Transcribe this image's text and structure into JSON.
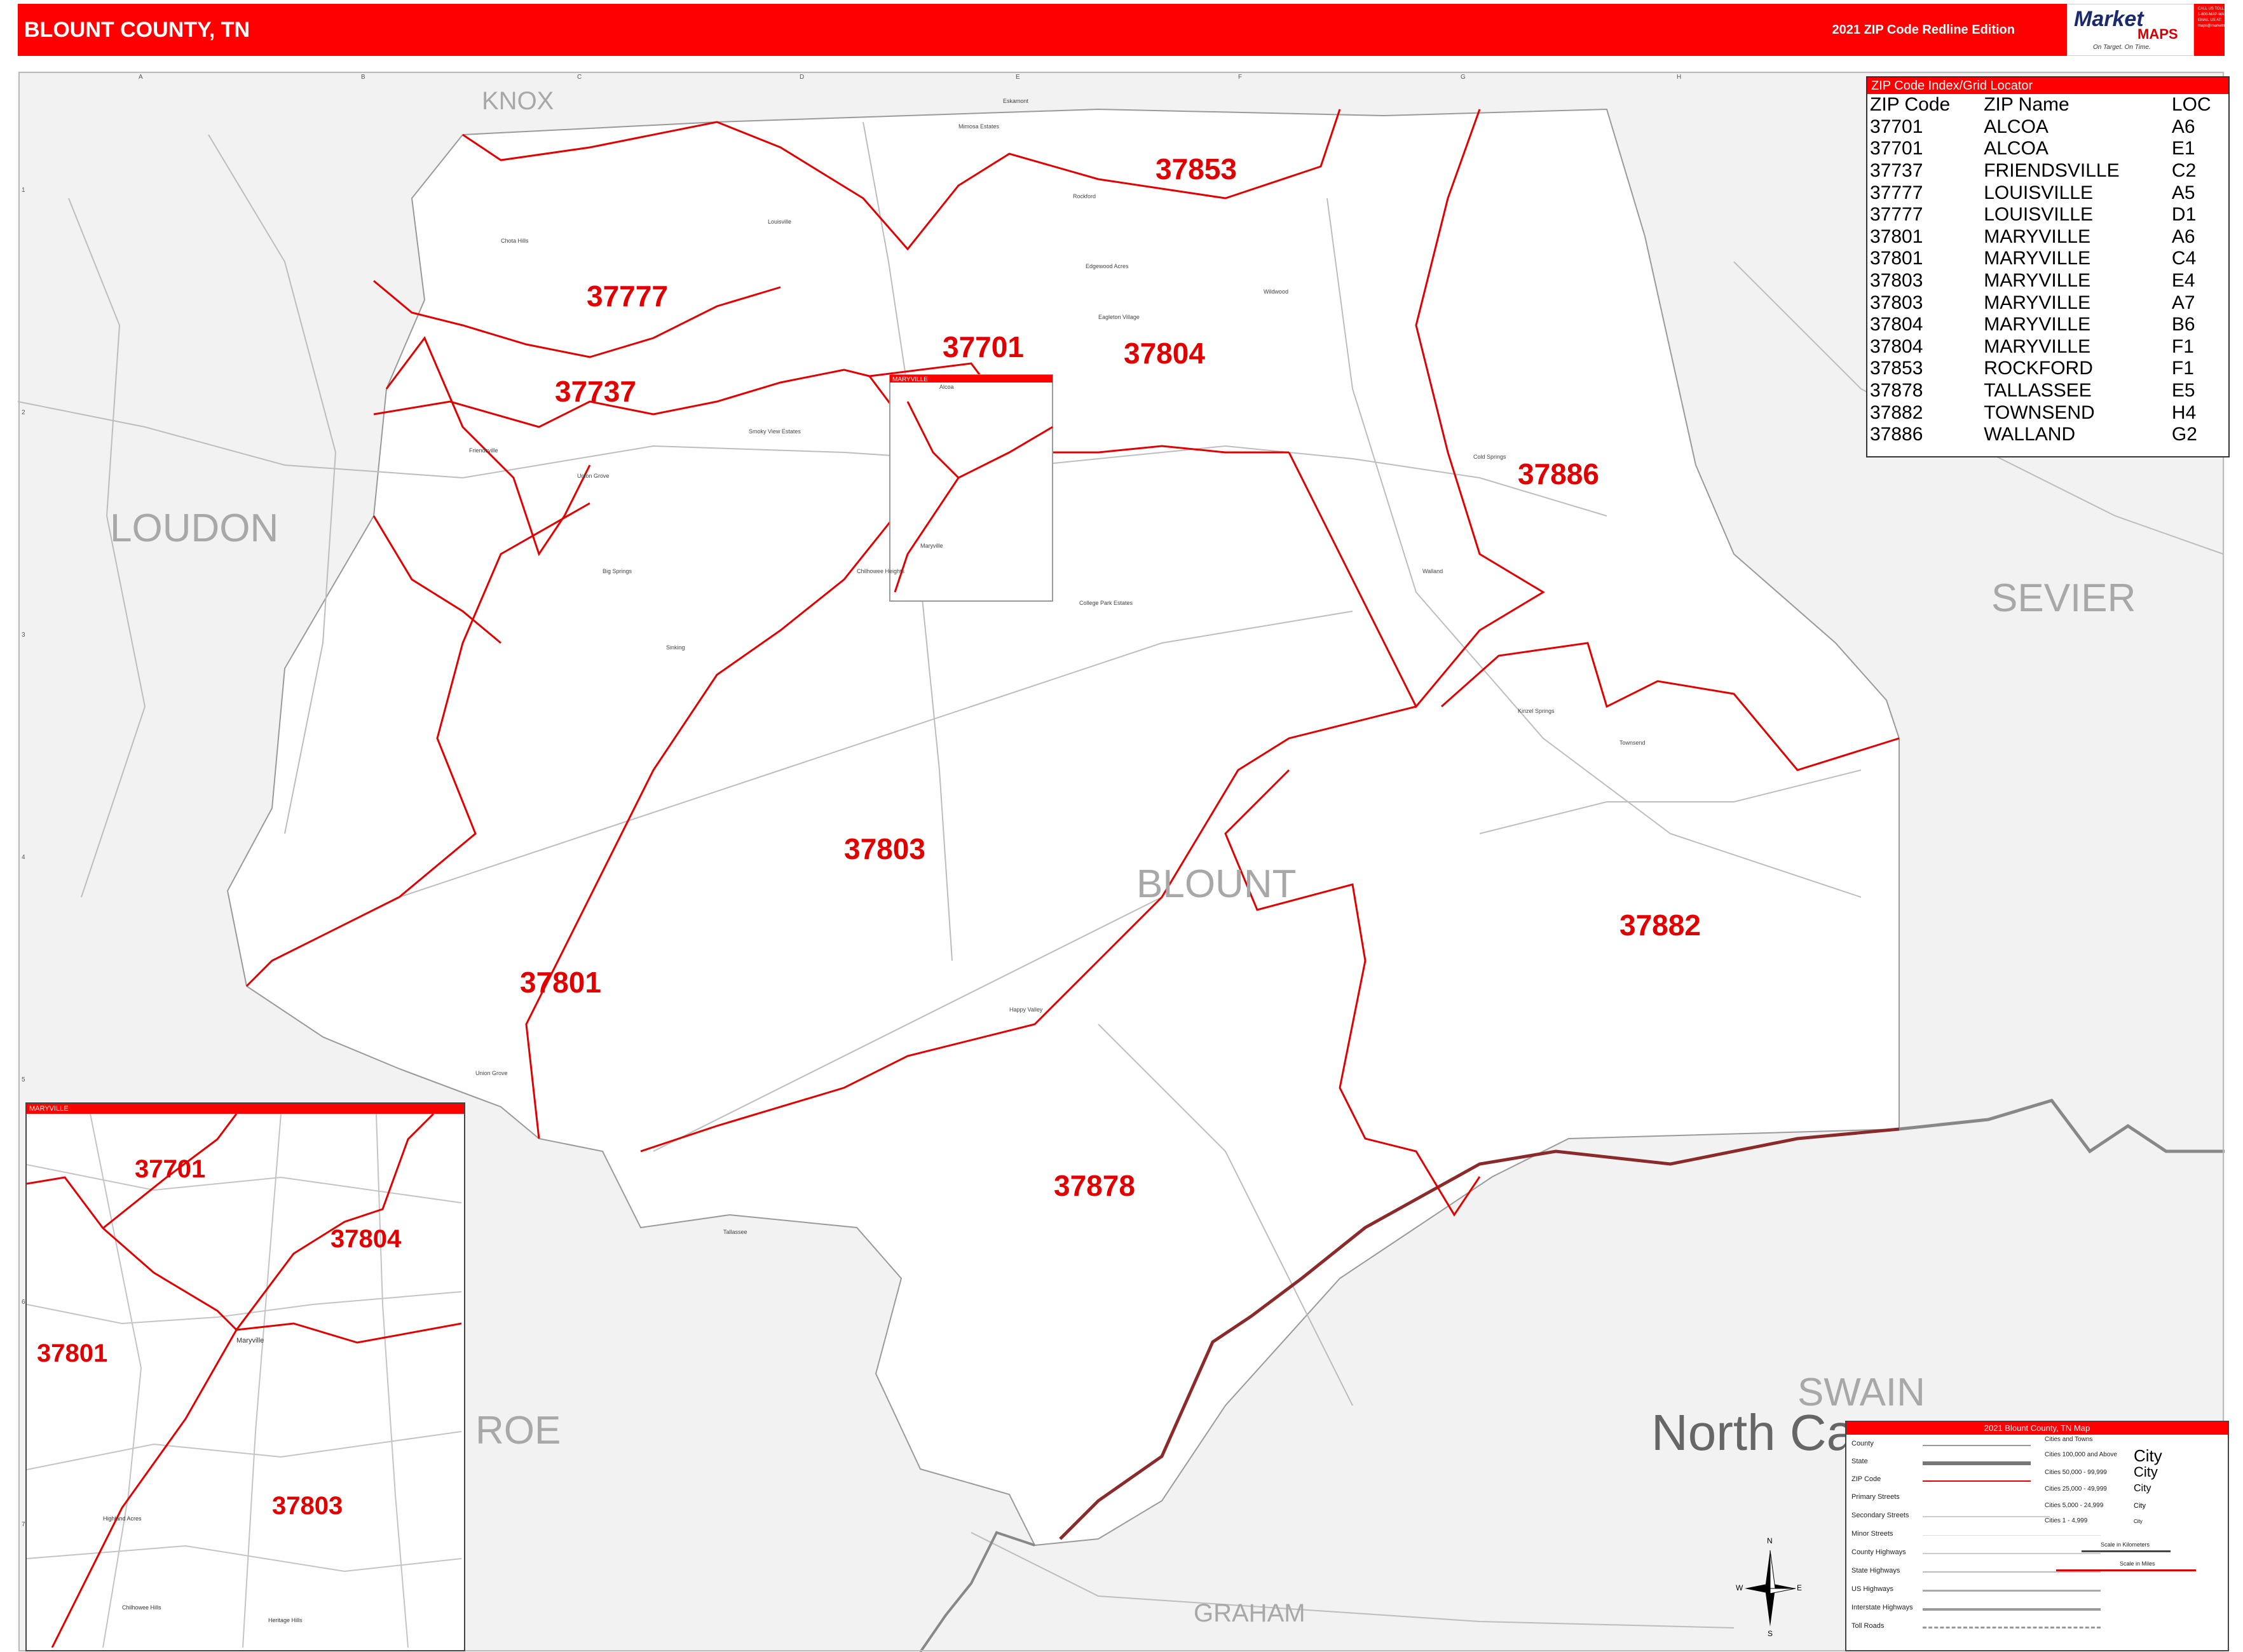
{
  "header": {
    "title": "BLOUNT COUNTY, TN",
    "edition": "2021 ZIP Code Redline Edition"
  },
  "logo": {
    "brand1": "Market",
    "brand2": "MAPS",
    "tagline": "On Target. On Time.",
    "subtag": "America's Leading Source of Business Maps",
    "contact": "CALL US TOLL FREE 1-800-MAP-MASTER EMAIL US AT: maps@marketmaps.com"
  },
  "grid": {
    "columns": [
      "A",
      "B",
      "C",
      "D",
      "E",
      "F",
      "G",
      "H"
    ],
    "rows": [
      "1",
      "2",
      "3",
      "4",
      "5",
      "6",
      "7"
    ]
  },
  "counties": {
    "knox": "KNOX",
    "loudon": "LOUDON",
    "sevier": "SEVIER",
    "blount": "BLOUNT",
    "swain": "SWAIN",
    "graham": "GRAHAM",
    "monroe": "ROE",
    "state": "North Ca"
  },
  "zip_labels": {
    "z37853": "37853",
    "z37777": "37777",
    "z37701": "37701",
    "z37804": "37804",
    "z37737": "37737",
    "z37886": "37886",
    "z37803": "37803",
    "z37882": "37882",
    "z37801": "37801",
    "z37878": "37878"
  },
  "places": {
    "p1": "Eskamont",
    "p2": "Mimosa Estates",
    "p3": "Rockford",
    "p4": "Chota Hills",
    "p5": "Louisville",
    "p6": "Wildwood",
    "p7": "Edgewood Acres",
    "p8": "Eagleton Village",
    "p9": "Friendsville",
    "p10": "Union Grove",
    "p11": "Smoky View Estates",
    "p12": "Big Springs",
    "p13": "Cold Springs",
    "p14": "Walland",
    "p15": "Sinking",
    "p16": "Chilhowee Heights",
    "p17": "College Park Estates",
    "p18": "Maryville",
    "p19": "Kinzel Springs",
    "p20": "Townsend",
    "p21": "Happy Valley",
    "p22": "Union Grove",
    "p23": "Tallassee",
    "p24": "Alcoa"
  },
  "zip_index": {
    "title": "ZIP Code Index/Grid Locator",
    "headers": [
      "ZIP Code",
      "ZIP Name",
      "LOC"
    ],
    "rows": [
      [
        "37701",
        "ALCOA",
        "A6"
      ],
      [
        "37701",
        "ALCOA",
        "E1"
      ],
      [
        "37737",
        "FRIENDSVILLE",
        "C2"
      ],
      [
        "37777",
        "LOUISVILLE",
        "A5"
      ],
      [
        "37777",
        "LOUISVILLE",
        "D1"
      ],
      [
        "37801",
        "MARYVILLE",
        "A6"
      ],
      [
        "37801",
        "MARYVILLE",
        "C4"
      ],
      [
        "37803",
        "MARYVILLE",
        "E4"
      ],
      [
        "37803",
        "MARYVILLE",
        "A7"
      ],
      [
        "37804",
        "MARYVILLE",
        "B6"
      ],
      [
        "37804",
        "MARYVILLE",
        "F1"
      ],
      [
        "37853",
        "ROCKFORD",
        "F1"
      ],
      [
        "37878",
        "TALLASSEE",
        "E5"
      ],
      [
        "37882",
        "TOWNSEND",
        "H4"
      ],
      [
        "37886",
        "WALLAND",
        "G2"
      ]
    ]
  },
  "inset": {
    "title": "MARYVILLE",
    "main_tag": "MARYVILLE",
    "zips": {
      "a": "37701",
      "b": "37804",
      "c": "37801",
      "d": "37803"
    },
    "places": {
      "p1": "Maryville",
      "p2": "Highland Acres",
      "p3": "Heritage Hills",
      "p4": "Chilhowee Hills"
    }
  },
  "legend": {
    "title": "2021 Blount County, TN Map",
    "items": [
      "County",
      "State",
      "ZIP Code",
      "Primary Streets",
      "Secondary Streets",
      "Minor Streets",
      "County Highways",
      "State Highways",
      "US Highways",
      "Interstate Highways",
      "Toll Roads"
    ],
    "cities_title": "Cities and Towns",
    "cities": [
      {
        "range": "Cities 100,000 and Above",
        "sample": "City"
      },
      {
        "range": "Cities 50,000 - 99,999",
        "sample": "City"
      },
      {
        "range": "Cities 25,000 - 49,999",
        "sample": "City"
      },
      {
        "range": "Cities 5,000 - 24,999",
        "sample": "City"
      },
      {
        "range": "Cities 1 - 4,999",
        "sample": "City"
      }
    ],
    "scale_km": "Scale in Kilometers",
    "scale_mi": "Scale in Miles"
  },
  "compass": {
    "n": "N",
    "s": "S",
    "e": "E",
    "w": "W"
  },
  "colors": {
    "red": "#ff0000",
    "zip_line": "#e00000",
    "state_line": "#8b2a2a",
    "gray_fill": "#f2f2f2",
    "road": "#bdbdbd"
  }
}
